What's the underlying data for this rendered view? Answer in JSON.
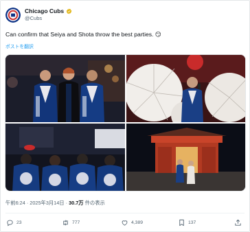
{
  "tweet": {
    "display_name": "Chicago Cubs",
    "handle": "@Cubs",
    "text": "Can confirm that Seiya and Shota throw the best parties. 😏",
    "translate_label": "ポストを翻訳",
    "time": "午前6:24",
    "date": "2025年3月14日",
    "views_count": "30.7万",
    "views_label": "件の表示",
    "separator": "·"
  },
  "actions": {
    "replies": "23",
    "reposts": "777",
    "likes": "4,389",
    "bookmarks": "137"
  },
  "photos": [
    {
      "name": "cubs-players-in-happi-coats"
    },
    {
      "name": "player-with-paper-umbrellas"
    },
    {
      "name": "group-from-behind-at-party"
    },
    {
      "name": "players-at-shrine-gate"
    }
  ],
  "icons": {
    "avatar": "cubs-logo-icon",
    "verified": "gold-verified-badge-icon",
    "reply": "reply-icon",
    "repost": "repost-icon",
    "like": "heart-icon",
    "bookmark": "bookmark-icon",
    "share": "share-icon"
  },
  "colors": {
    "link": "#1d9bf0",
    "secondary_text": "#536471",
    "verified_gold": "#e2b719",
    "cubs_blue": "#0e3386",
    "cubs_red": "#cc3433"
  }
}
